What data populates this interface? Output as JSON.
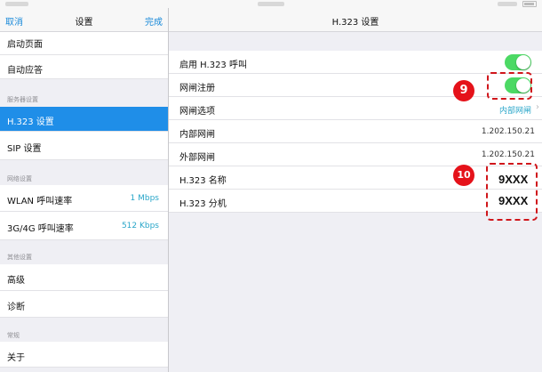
{
  "left_nav": {
    "cancel": "取消",
    "title": "设置",
    "done": "完成"
  },
  "left_items": {
    "start_page": "启动页面",
    "auto_answer": "自动应答",
    "server_header": "服务器设置",
    "h323": "H.323 设置",
    "sip": "SIP 设置",
    "network_header": "网络设置",
    "wlan_rate_label": "WLAN 呼叫速率",
    "wlan_rate_value": "1 Mbps",
    "cell_rate_label": "3G/4G 呼叫速率",
    "cell_rate_value": "512 Kbps",
    "other_header": "其他设置",
    "advanced": "高级",
    "diagnostics": "诊断",
    "general_header": "常规",
    "about": "关于"
  },
  "right_nav": {
    "title": "H.323 设置"
  },
  "h323": {
    "enable_label": "启用 H.323 呼叫",
    "enable_on": true,
    "gk_reg_label": "网闸注册",
    "gk_reg_on": true,
    "gk_option_label": "网闸选项",
    "gk_option_value": "内部网闸",
    "internal_gk_label": "内部网闸",
    "internal_gk_value": "1.202.150.21",
    "external_gk_label": "外部网闸",
    "external_gk_value": "1.202.150.21",
    "name_label": "H.323 名称",
    "name_value": "9XXX",
    "ext_label": "H.323 分机",
    "ext_value": "9XXX"
  },
  "annotations": {
    "badge_9": "9",
    "badge_10": "10"
  },
  "colors": {
    "accent": "#1a8ad9",
    "selected": "#1f8ee8",
    "toggle_on": "#4cd964",
    "annotation_red": "#d0161b"
  }
}
